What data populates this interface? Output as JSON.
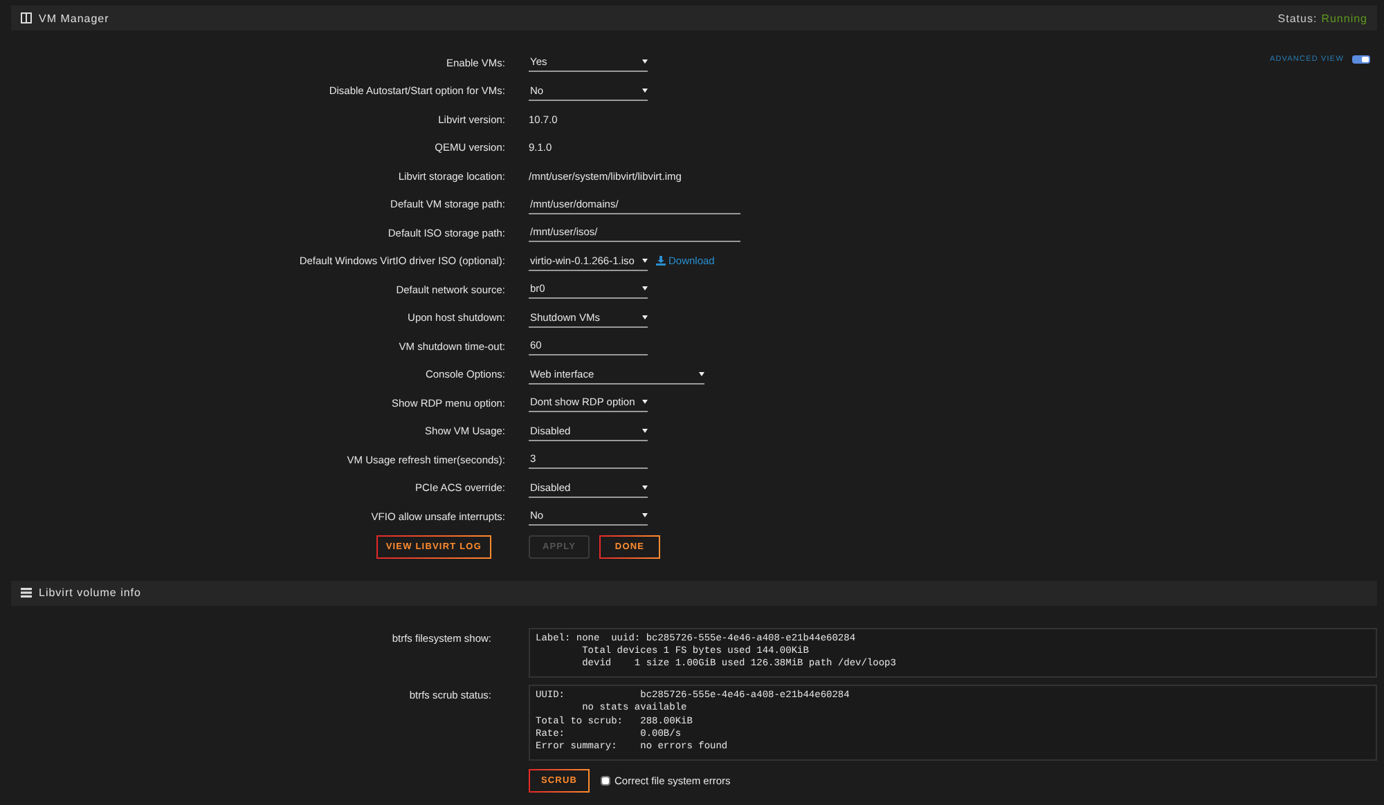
{
  "vm_manager": {
    "title": "VM Manager",
    "status_label": "Status:",
    "status_value": "Running",
    "advanced_view": {
      "label": "ADVANCED VIEW",
      "on": true
    },
    "settings": [
      {
        "label": "Enable VMs:",
        "kind": "select",
        "value": "Yes"
      },
      {
        "label": "Disable Autostart/Start option for VMs:",
        "kind": "select",
        "value": "No"
      },
      {
        "label": "Libvirt version:",
        "kind": "text",
        "value": "10.7.0"
      },
      {
        "label": "QEMU version:",
        "kind": "text",
        "value": "9.1.0"
      },
      {
        "label": "Libvirt storage location:",
        "kind": "text",
        "value": "/mnt/user/system/libvirt/libvirt.img"
      },
      {
        "label": "Default VM storage path:",
        "kind": "input",
        "value": "/mnt/user/domains/"
      },
      {
        "label": "Default ISO storage path:",
        "kind": "input",
        "value": "/mnt/user/isos/"
      },
      {
        "label": "Default Windows VirtIO driver ISO (optional):",
        "kind": "select",
        "value": "virtio-win-0.1.266-1.iso",
        "link": "Download"
      },
      {
        "label": "Default network source:",
        "kind": "select",
        "value": "br0"
      },
      {
        "label": "Upon host shutdown:",
        "kind": "select",
        "value": "Shutdown VMs"
      },
      {
        "label": "VM shutdown time-out:",
        "kind": "short-input",
        "value": "60"
      },
      {
        "label": "Console Options:",
        "kind": "wide-select",
        "value": "Web interface"
      },
      {
        "label": "Show RDP menu option:",
        "kind": "select",
        "value": "Dont show RDP option"
      },
      {
        "label": "Show VM Usage:",
        "kind": "select",
        "value": "Disabled"
      },
      {
        "label": "VM Usage refresh timer(seconds):",
        "kind": "short-input",
        "value": "3"
      },
      {
        "label": "PCIe ACS override:",
        "kind": "select",
        "value": "Disabled"
      },
      {
        "label": "VFIO allow unsafe interrupts:",
        "kind": "select",
        "value": "No"
      }
    ],
    "log_button": {
      "label": "VIEW LIBVIRT LOG",
      "disabled": false
    },
    "buttons": [
      {
        "label": "APPLY",
        "disabled": true
      },
      {
        "label": "DONE",
        "disabled": false
      }
    ]
  },
  "volume_info": {
    "title": "Libvirt volume info",
    "outputs": [
      {
        "label": "btrfs filesystem show:",
        "lines": [
          "Label: none  uuid: bc285726-555e-4e46-a408-e21b44e60284",
          "        Total devices 1 FS bytes used 144.00KiB",
          "        devid    1 size 1.00GiB used 126.38MiB path /dev/loop3"
        ]
      },
      {
        "label": "btrfs scrub status:",
        "lines": [
          "UUID:             bc285726-555e-4e46-a408-e21b44e60284",
          "        no stats available",
          "Total to scrub:   288.00KiB",
          "Rate:             0.00B/s",
          "Error summary:    no errors found"
        ]
      }
    ],
    "scrub_button": {
      "label": "SCRUB",
      "disabled": false
    },
    "correct_errors": {
      "label": "Correct file system errors",
      "checked": false
    }
  }
}
